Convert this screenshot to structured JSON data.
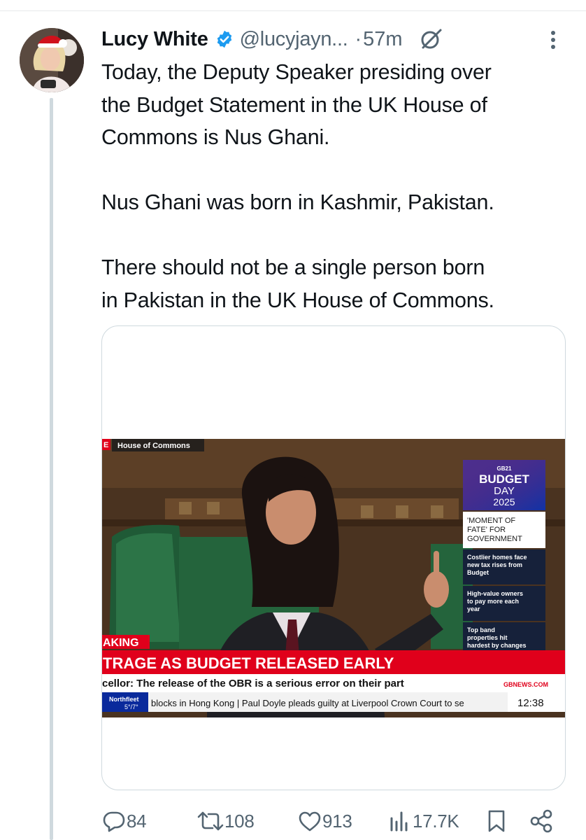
{
  "tweet": {
    "author_name": "Lucy White",
    "handle": "@lucyjayn...",
    "separator": "·",
    "timestamp": "57m",
    "paragraphs": [
      [
        "Today, the Deputy Speaker presiding over",
        "the Budget Statement in the UK House of",
        "Commons is Nus Ghani."
      ],
      [
        "Nus Ghani was born in Kashmir, Pakistan."
      ],
      [
        "There should not be a single person born",
        "in Pakistan in the UK House of Commons."
      ]
    ]
  },
  "media": {
    "location_label": "House of Commons",
    "graphic_brand": "GB21",
    "graphic_title_1": "BUDGET",
    "graphic_title_2": "DAY",
    "graphic_year": "2025",
    "side_headline": [
      "'MOMENT OF",
      "FATE' FOR",
      "GOVERNMENT"
    ],
    "side_stories": [
      [
        "Costlier homes face",
        "new tax rises from",
        "Budget"
      ],
      [
        "High-value owners",
        "to pay more each",
        "year"
      ],
      [
        "Top band",
        "properties hit",
        "hardest by changes"
      ]
    ],
    "breaking_label": "AKING",
    "headline": "TRAGE AS BUDGET RELEASED EARLY",
    "subheadline": "cellor: The release of the OBR is a serious error on their part",
    "channel_url": "GBNEWS.COM",
    "weather_place": "Northfleet",
    "weather_temp": "5°/7°",
    "ticker": "blocks in Hong Kong  |  Paul Doyle pleads guilty at Liverpool Crown Court to se",
    "clock": "12:38",
    "live_tag": "E"
  },
  "actions": {
    "replies": "84",
    "reposts": "108",
    "likes": "913",
    "views": "17.7K"
  },
  "colors": {
    "text": "#0f1419",
    "secondary": "#536471",
    "verified": "#1d9bf0",
    "border": "#cfd9de",
    "news_red": "#e0001b",
    "news_blue": "#0a2a9c"
  },
  "icons": [
    "verified-icon",
    "grok-icon",
    "more-icon",
    "reply-icon",
    "repost-icon",
    "like-icon",
    "views-icon",
    "bookmark-icon",
    "share-icon"
  ]
}
